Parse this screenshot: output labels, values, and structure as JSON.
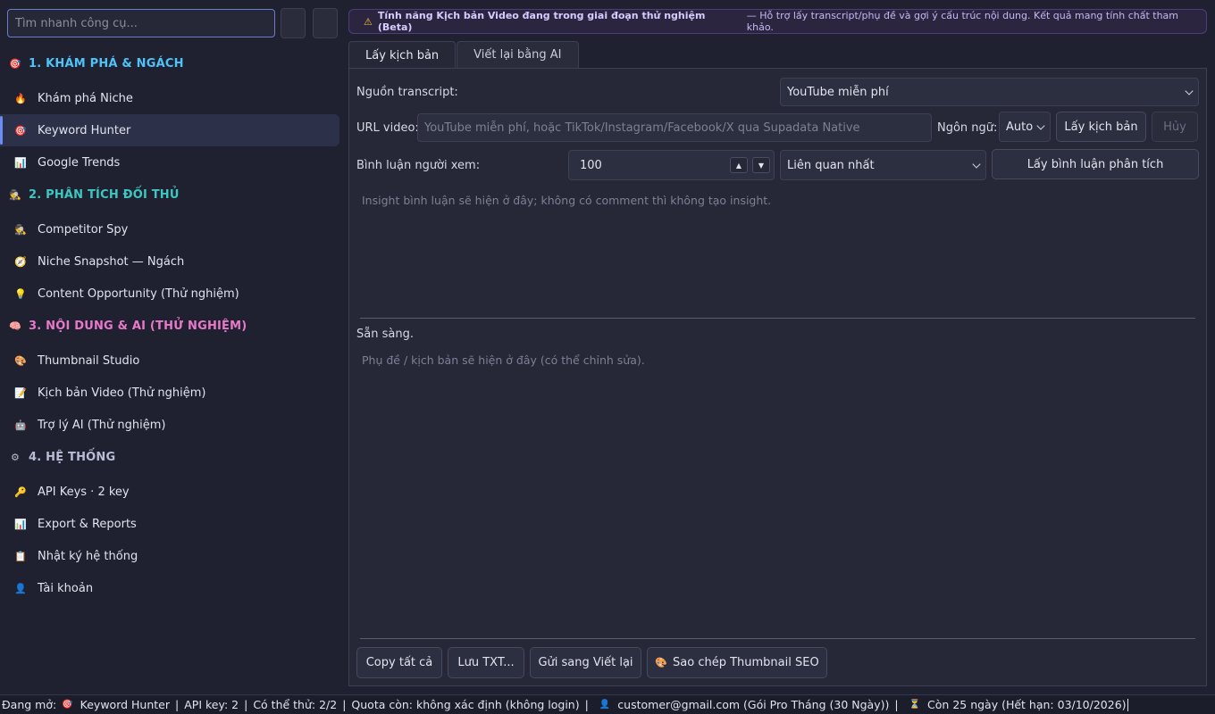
{
  "sidebar": {
    "search_placeholder": "Tìm nhanh công cụ...",
    "sections": [
      {
        "title": "1. KHÁM PHÁ & NGÁCH",
        "icon": "target-icon",
        "glyph": "🎯",
        "color": "#4fc3f7",
        "items": [
          {
            "label": "Khám phá Niche",
            "icon": "fire-icon",
            "glyph": "🔥"
          },
          {
            "label": "Keyword Hunter",
            "icon": "target-icon",
            "glyph": "🎯",
            "active": true
          },
          {
            "label": "Google Trends",
            "icon": "chart-icon",
            "glyph": "📊"
          }
        ]
      },
      {
        "title": "2. PHÂN TÍCH ĐỐI THỦ",
        "icon": "spy-icon",
        "glyph": "🕵",
        "color": "#3ec6c0",
        "items": [
          {
            "label": "Competitor Spy",
            "icon": "spy-icon",
            "glyph": "🕵"
          },
          {
            "label": "Niche Snapshot — Ngách",
            "icon": "compass-icon",
            "glyph": "🧭"
          },
          {
            "label": "Content Opportunity (Thử nghiệm)",
            "icon": "bulb-icon",
            "glyph": "💡"
          }
        ]
      },
      {
        "title": "3. NỘI DUNG & AI (THỬ NGHIỆM)",
        "icon": "brain-icon",
        "glyph": "🧠",
        "color": "#e879c9",
        "items": [
          {
            "label": "Thumbnail Studio",
            "icon": "palette-icon",
            "glyph": "🎨"
          },
          {
            "label": "Kịch bản Video (Thử nghiệm)",
            "icon": "script-icon",
            "glyph": "📝"
          },
          {
            "label": "Trợ lý AI (Thử nghiệm)",
            "icon": "robot-icon",
            "glyph": "🤖"
          }
        ]
      },
      {
        "title": "4. HỆ THỐNG",
        "icon": "gear-icon",
        "glyph": "⚙",
        "color": "#b8bdd6",
        "items": [
          {
            "label": "API Keys · 2 key",
            "icon": "key-icon",
            "glyph": "🔑"
          },
          {
            "label": "Export & Reports",
            "icon": "chart-icon",
            "glyph": "📊"
          },
          {
            "label": "Nhật ký hệ thống",
            "icon": "clipboard-icon",
            "glyph": "📋"
          },
          {
            "label": "Tài khoản",
            "icon": "user-icon",
            "glyph": "👤"
          }
        ]
      }
    ]
  },
  "banner": {
    "icon": "warning-icon",
    "glyph": "⚠",
    "bold": "Tính năng Kịch bản Video đang trong giai đoạn thử nghiệm (Beta)",
    "text": "— Hỗ trợ lấy transcript/phụ đề và gợi ý cấu trúc nội dung. Kết quả mang tính chất tham khảo."
  },
  "tabs": [
    {
      "label": "Lấy kịch bản",
      "active": true
    },
    {
      "label": "Viết lại bằng AI",
      "active": false
    }
  ],
  "form": {
    "source_label": "Nguồn transcript:",
    "source_value": "YouTube miễn phí",
    "url_label": "URL video:",
    "url_placeholder": "YouTube miễn phí, hoặc TikTok/Instagram/Facebook/X qua Supadata Native",
    "lang_label": "Ngôn ngữ:",
    "lang_value": "Auto",
    "get_script_button": "Lấy kịch bản",
    "cancel_button": "Hủy",
    "comments_label": "Bình luận người xem:",
    "comments_count": "100",
    "comments_sort": "Liên quan nhất",
    "get_comments_button": "Lấy bình luận  phân tích",
    "insight_placeholder": "Insight bình luận sẽ hiện ở đây; không có comment thì không tạo insight.",
    "status": "Sẵn sàng.",
    "transcript_placeholder": "Phụ đề / kịch bản sẽ hiện ở đây (có thể chỉnh sửa)."
  },
  "actions": {
    "copy_all": "Copy tất cả",
    "save_txt": "Lưu TXT...",
    "send_rewrite": "Gửi sang Viết lại",
    "copy_thumbnail_icon": "palette-icon",
    "copy_thumbnail_glyph": "🎨",
    "copy_thumbnail": "Sao chép Thumbnail  SEO"
  },
  "status_bar": {
    "open_prefix": "Đang mở:",
    "open_icon": "target-icon",
    "open_glyph": "🎯",
    "open_name": "Keyword Hunter",
    "api_key": "API key: 2",
    "possible": "Có thể thử: 2/2",
    "quota": "Quota còn: không xác định (không login)",
    "user_icon": "user-icon",
    "user_glyph": "👤",
    "user": "customer@gmail.com (Gói Pro Tháng (30 Ngày))",
    "hourglass_icon": "hourglass-icon",
    "hourglass_glyph": "⏳",
    "remaining": "Còn 25 ngày (Hết hạn: 03/10/2026)"
  }
}
